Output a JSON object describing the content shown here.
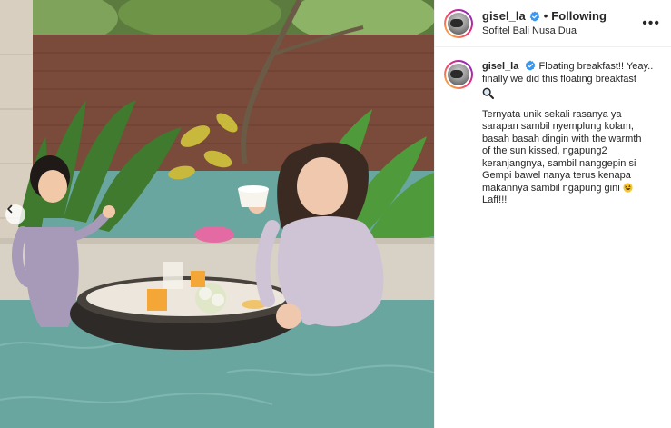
{
  "post": {
    "username": "gisel_la",
    "verified": true,
    "follow_status": "Following",
    "separator": "•",
    "location": "Sofitel Bali Nusa Dua",
    "more_icon": "more-horizontal-icon",
    "more_label": "•••"
  },
  "caption": {
    "username": "gisel_la",
    "line1": "Floating breakfast!! Yeay..",
    "line2": "finally we did this floating breakfast",
    "emoji1": "magnifier-emoji",
    "paragraph_lines": [
      "Ternyata unik sekali rasanya ya",
      "sarapan sambil nyemplung kolam,",
      "basah basah dingin with the warmth",
      "of the sun kissed, ngapung2",
      "keranjangnya, sambil nanggepin si",
      "Gempi bawel nanya terus kenapa",
      "makannya sambil ngapung gini",
      "Laff!!!"
    ],
    "emoji2": "rolling-laughing-emoji"
  },
  "media": {
    "prev_icon": "chevron-left-icon",
    "alt": "photo"
  },
  "colors": {
    "verified_blue": "#3897f0",
    "text": "#262626",
    "pool": "#6aa6a0",
    "wall": "#7a4a3a"
  }
}
